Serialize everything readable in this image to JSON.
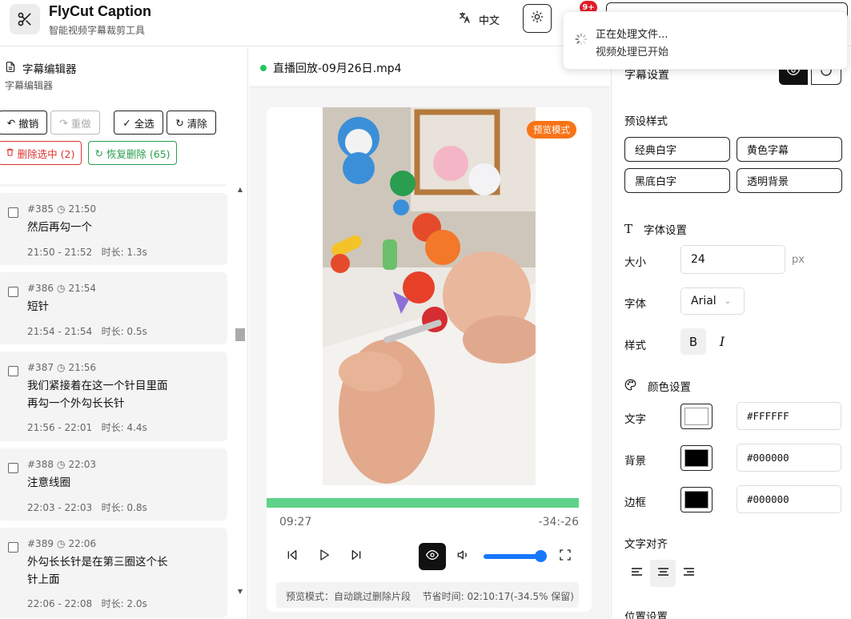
{
  "app": {
    "title": "FlyCut Caption",
    "subtitle": "智能视频字幕裁剪工具",
    "icon": "scissors-icon"
  },
  "header": {
    "language": "中文",
    "language_icon": "translate-icon",
    "theme_icon": "sun-icon",
    "notifications": "9+"
  },
  "toast": {
    "title": "正在处理文件...",
    "description": "视频处理已开始"
  },
  "editor": {
    "title": "字幕编辑器",
    "subtitle": "字幕编辑器",
    "buttons": {
      "undo": "撤销",
      "redo": "重做",
      "select_all": "全选",
      "clear": "清除",
      "delete_selected": "删除选中 (2)",
      "restore_deleted": "恢复删除 (65)"
    },
    "items": [
      {
        "index": "#385",
        "time": "21:50",
        "text": "然后再勾一个",
        "range": "21:50 - 21:52",
        "duration": "时长: 1.3s"
      },
      {
        "index": "#386",
        "time": "21:54",
        "text": "短针",
        "range": "21:54 - 21:54",
        "duration": "时长: 0.5s"
      },
      {
        "index": "#387",
        "time": "21:56",
        "text": "我们紧接着在这一个针目里面再勾一个外勾长长针",
        "range": "21:56 - 22:01",
        "duration": "时长: 4.4s"
      },
      {
        "index": "#388",
        "time": "22:03",
        "text": "注意线圈",
        "range": "22:03 - 22:03",
        "duration": "时长: 0.8s"
      },
      {
        "index": "#389",
        "time": "22:06",
        "text": "外勾长长针是在第三圈这个长针上面",
        "range": "22:06 - 22:08",
        "duration": "时长: 2.0s"
      }
    ]
  },
  "player": {
    "file_name": "直播回放-09月26日.mp4",
    "preview_badge": "预览模式",
    "current_time": "09:27",
    "remaining_time": "-34:-26",
    "progress": 1.0,
    "volume": 0.9,
    "info_left": "预览模式：自动跳过删除片段",
    "info_right": "节省时间: 02:10:17(-34.5% 保留)"
  },
  "settings": {
    "title": "字幕设置",
    "presets_label": "预设样式",
    "presets": [
      "经典白字",
      "黄色字幕",
      "黑底白字",
      "透明背景"
    ],
    "font_section": "字体设置",
    "size_label": "大小",
    "size_value": "24",
    "size_unit": "px",
    "font_label": "字体",
    "font_value": "Arial",
    "style_label": "样式",
    "bold": "B",
    "italic": "I",
    "color_section": "颜色设置",
    "text_color_label": "文字",
    "text_color": "#FFFFFF",
    "bg_color_label": "背景",
    "bg_color": "#000000",
    "border_color_label": "边框",
    "border_color": "#000000",
    "align_label": "文字对齐",
    "align_active": "center",
    "position_label": "位置设置"
  },
  "colors": {
    "accent": "#1677ff",
    "success": "#22c55e",
    "badge": "#f97316",
    "danger": "#d33"
  }
}
